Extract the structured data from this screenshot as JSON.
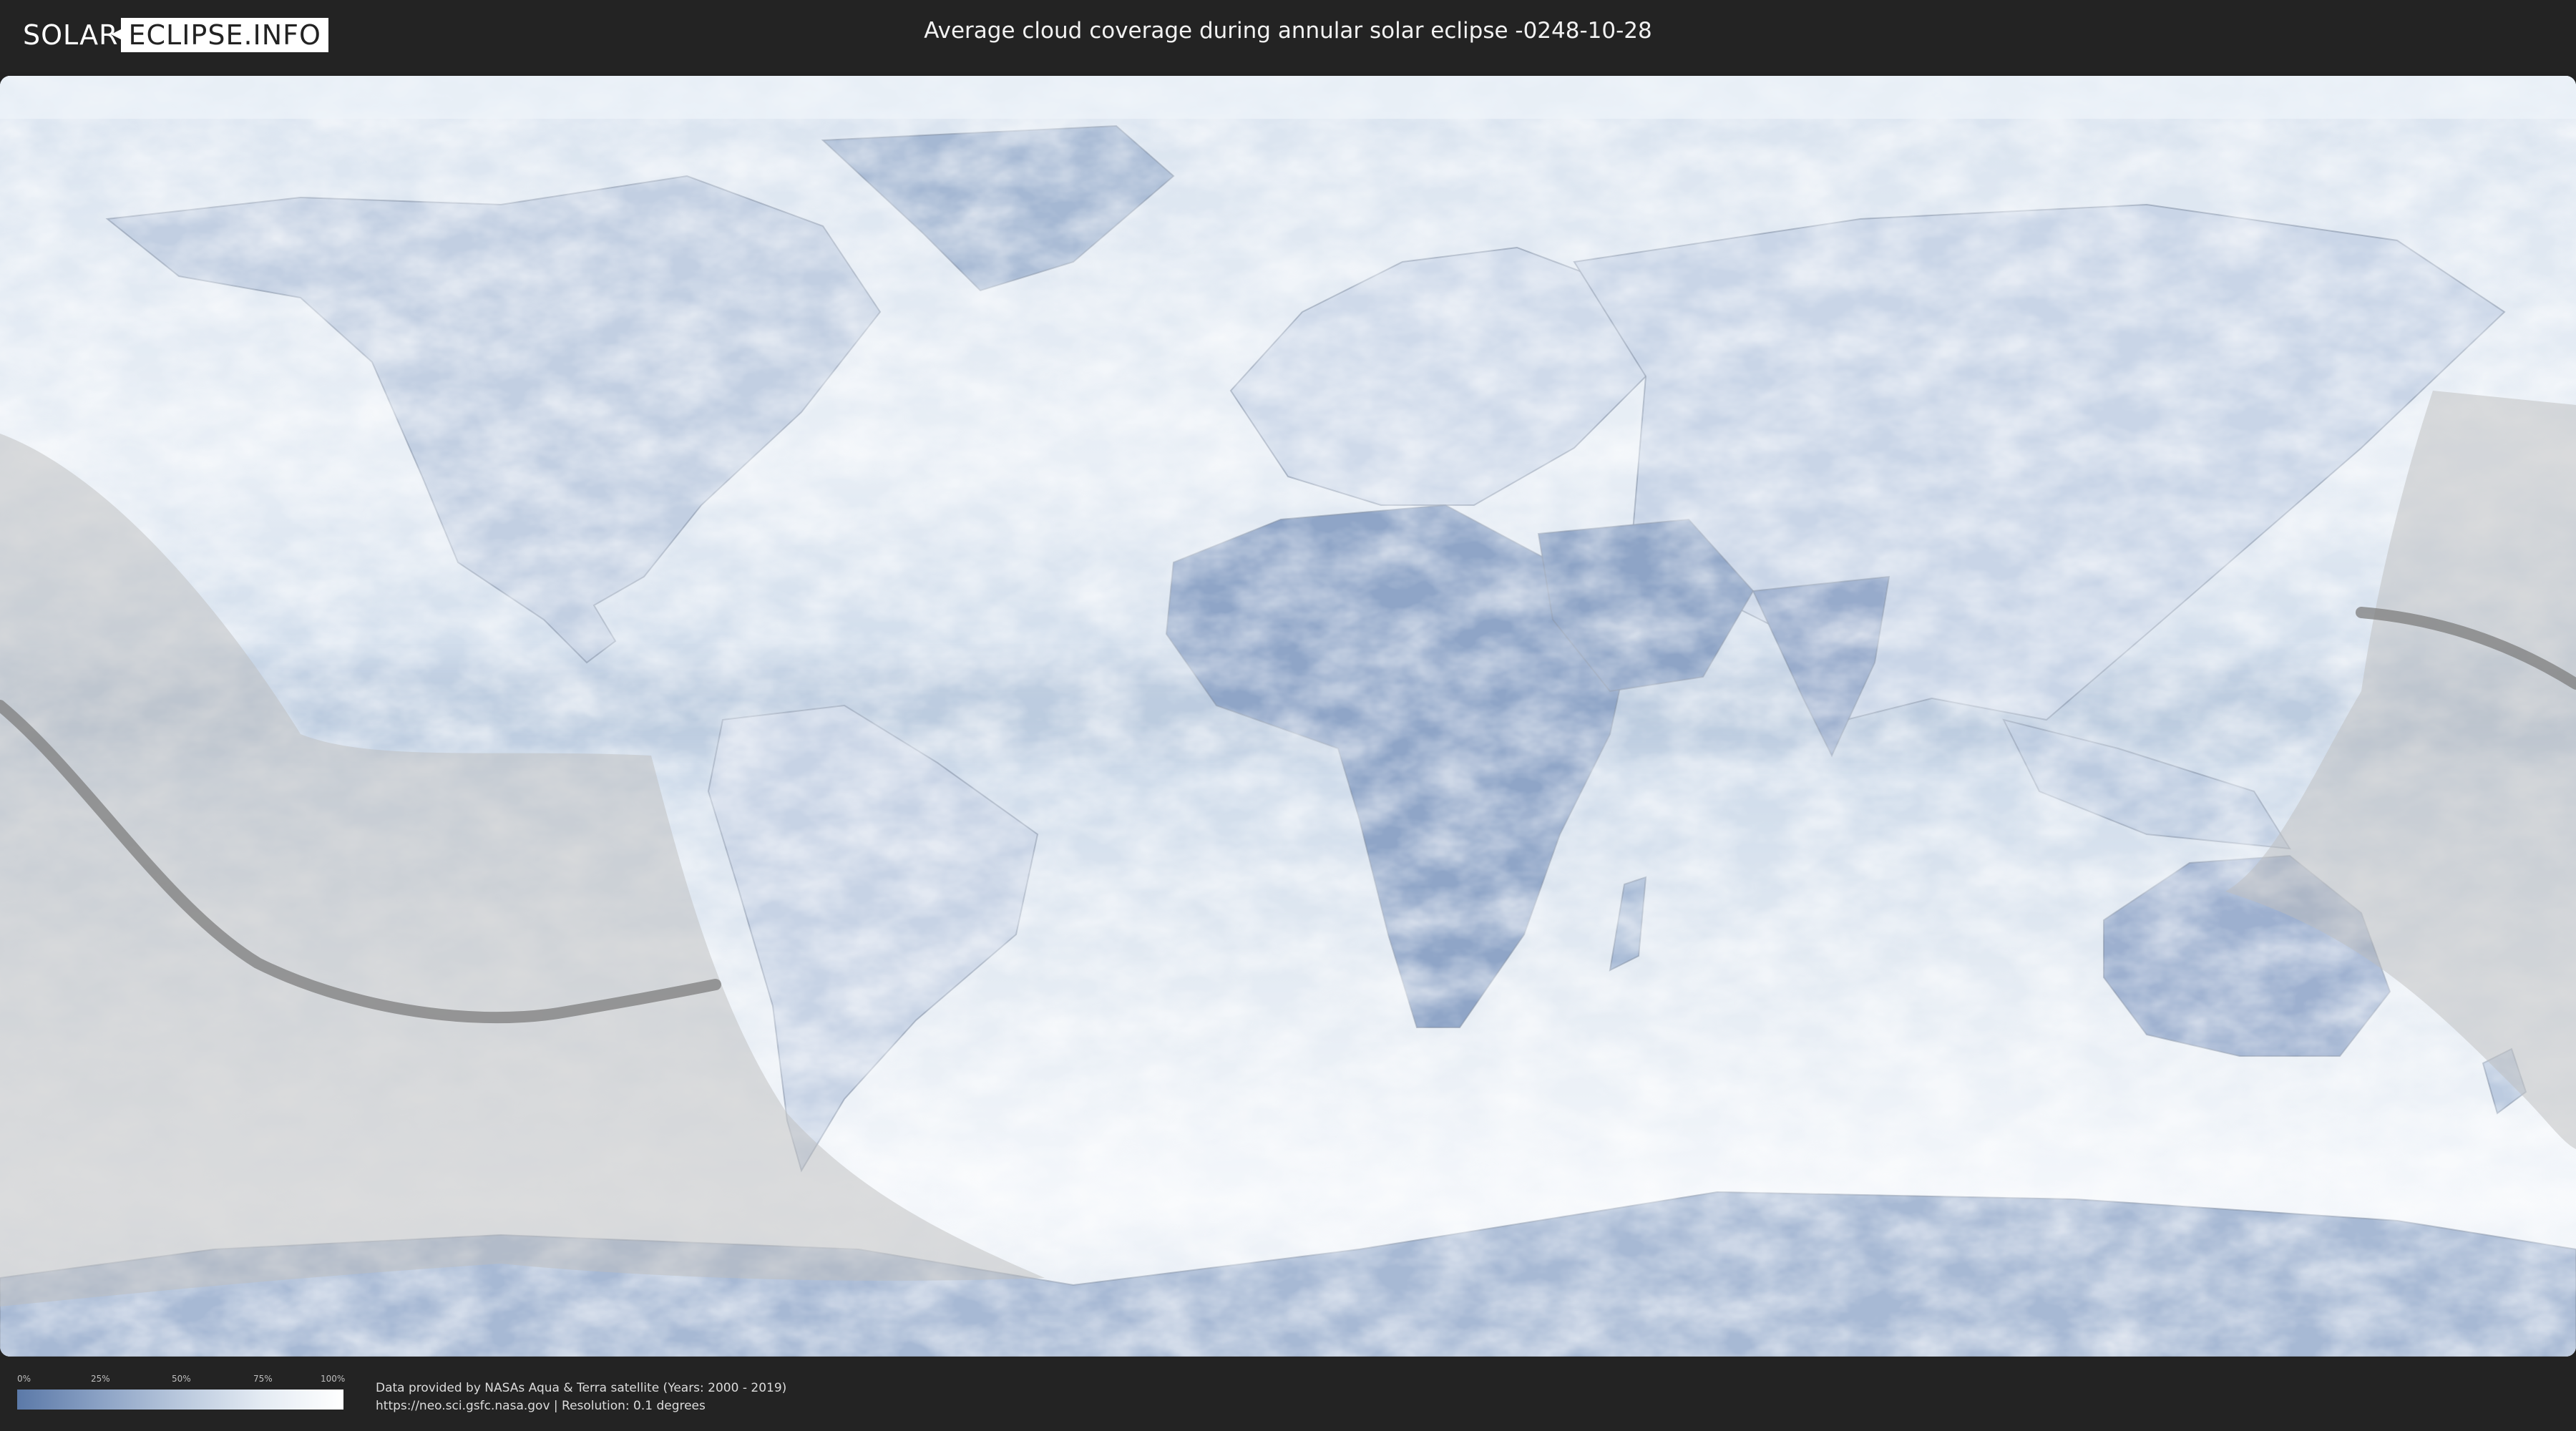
{
  "header": {
    "logo_left": "SOLAR",
    "logo_right": "ECLIPSE.INFO",
    "title": "Average cloud coverage during annular solar eclipse -0248-10-28"
  },
  "map": {
    "type": "cloud-coverage-world-map",
    "projection": "equirectangular",
    "colors": {
      "clear": "#5b79a8",
      "cloudy": "#ffffff",
      "penumbra_shade": "#bdbdbd",
      "central_path": "#7d7d7d"
    }
  },
  "legend": {
    "ticks": [
      "0%",
      "25%",
      "50%",
      "75%",
      "100%"
    ],
    "gradient_from": "#5b79a8",
    "gradient_to": "#ffffff"
  },
  "footer": {
    "credit_line1": "Data provided by NASAs Aqua & Terra satellite (Years: 2000 - 2019)",
    "credit_line2": "https://neo.sci.gsfc.nasa.gov | Resolution: 0.1 degrees"
  }
}
